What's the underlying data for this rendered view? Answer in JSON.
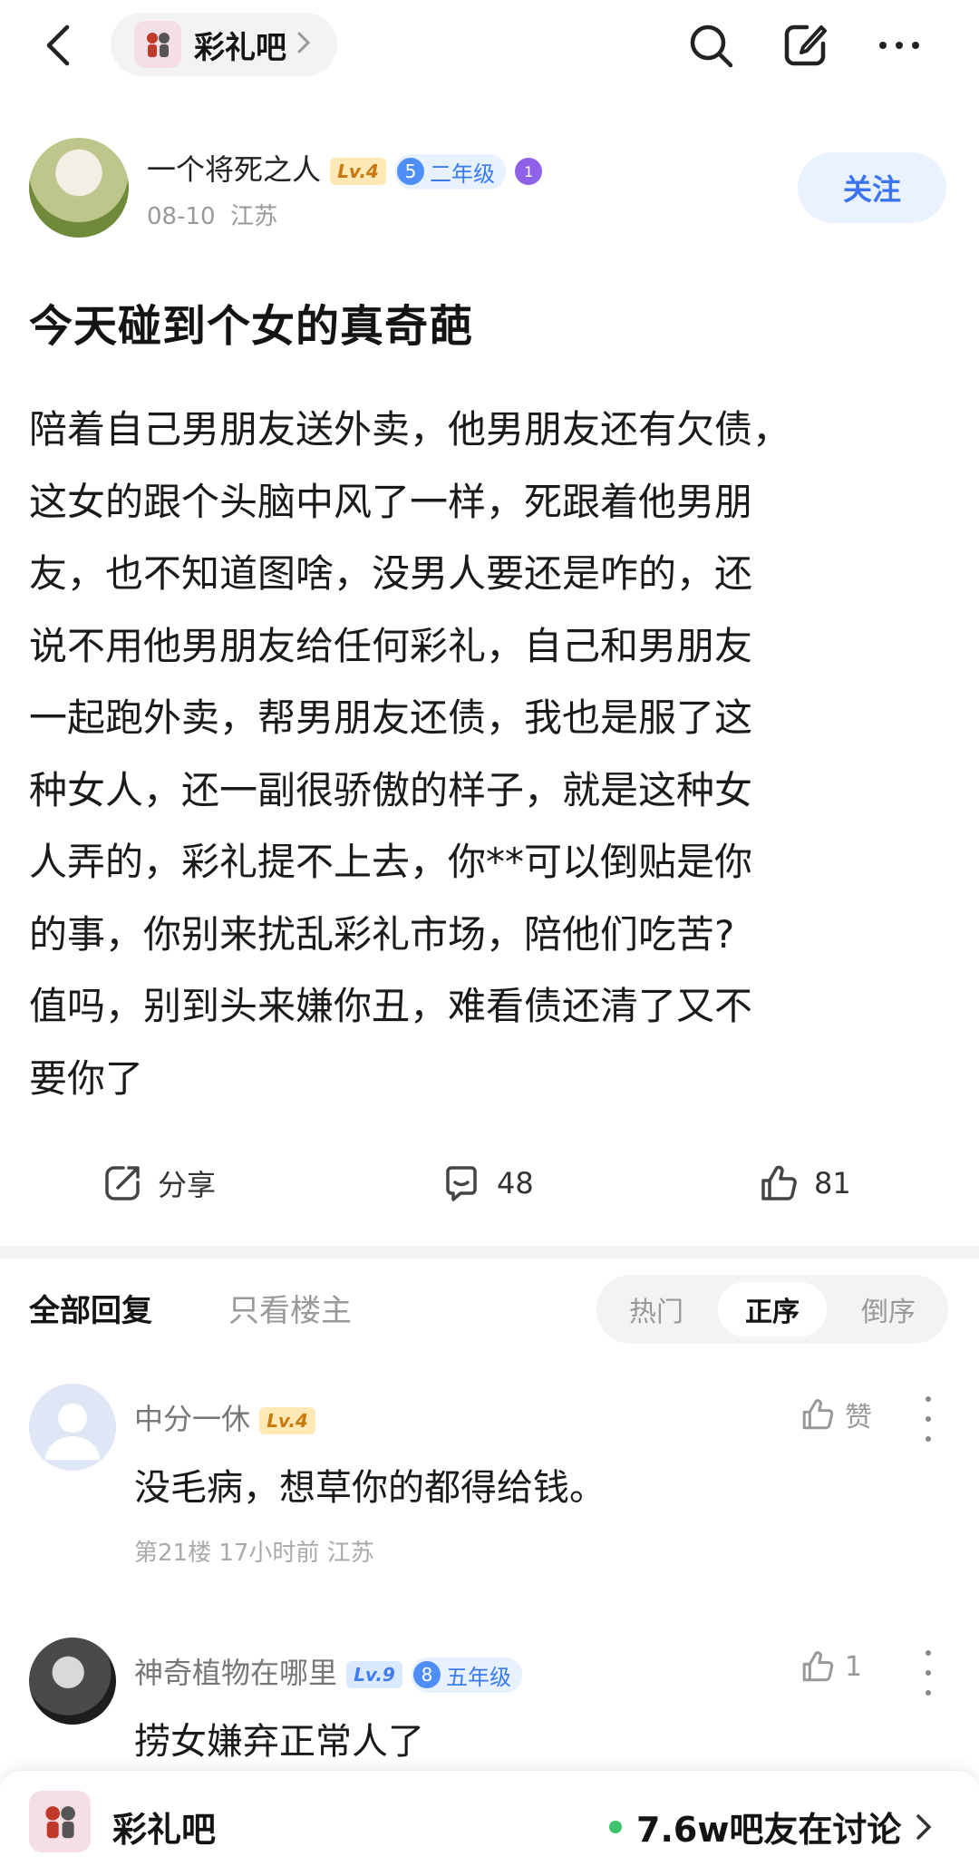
{
  "header": {
    "forum_name": "彩礼吧"
  },
  "post": {
    "author_name": "一个将死之人",
    "author_level": "Lv.4",
    "author_grade_num": "5",
    "author_grade": "二年级",
    "author_medal": "1",
    "date": "08-10",
    "location": "江苏",
    "follow_label": "关注",
    "title": "今天碰到个女的真奇葩",
    "body": "陪着自己男朋友送外卖，他男朋友还有欠债，\n这女的跟个头脑中风了一样，死跟着他男朋\n友，也不知道图啥，没男人要还是咋的，还\n说不用他男朋友给任何彩礼，自己和男朋友\n一起跑外卖，帮男朋友还债，我也是服了这\n种女人，还一副很骄傲的样子，就是这种女\n人弄的，彩礼提不上去，你**可以倒贴是你\n的事，你别来扰乱彩礼市场，陪他们吃苦?\n值吗，别到头来嫌你丑，难看债还清了又不\n要你了",
    "share_label": "分享",
    "comment_count": "48",
    "like_count": "81"
  },
  "replies": {
    "tab_all": "全部回复",
    "tab_owner": "只看楼主",
    "sort_hot": "热门",
    "sort_asc": "正序",
    "sort_desc": "倒序",
    "items": [
      {
        "name": "中分一休",
        "level": "Lv.4",
        "text": "没毛病，想草你的都得给钱。",
        "meta": "第21楼 17小时前 江苏",
        "like": "赞"
      },
      {
        "name": "神奇植物在哪里",
        "level": "Lv.9",
        "grade_num": "8",
        "grade": "五年级",
        "text": "捞女嫌弃正常人了",
        "like": "1"
      }
    ]
  },
  "bottom": {
    "forum_name": "彩礼吧",
    "online": "7.6w吧友在讨论"
  },
  "colors": {
    "accent": "#3b74f0",
    "online_dot": "#3cc46b"
  }
}
